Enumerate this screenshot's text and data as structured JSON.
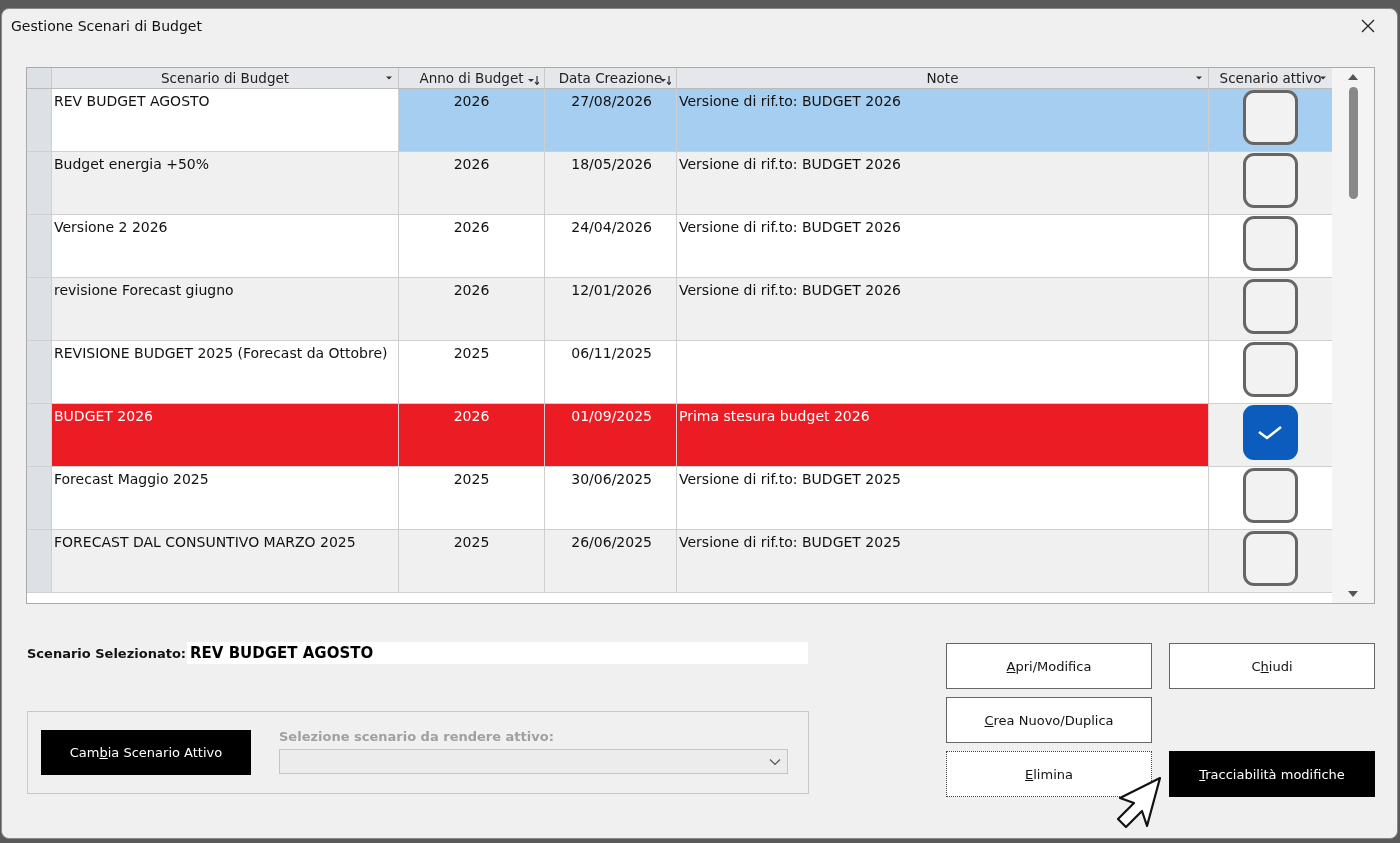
{
  "window": {
    "title": "Gestione Scenari di Budget"
  },
  "table": {
    "columns": [
      {
        "label": "Scenario di Budget",
        "sorted": false
      },
      {
        "label": "Anno di Budget",
        "sorted": true
      },
      {
        "label": "Data Creazione",
        "sorted": true
      },
      {
        "label": "Note",
        "sorted": false
      },
      {
        "label": "Scenario attivo",
        "sorted": false
      }
    ],
    "rows": [
      {
        "cells": [
          "REV BUDGET AGOSTO",
          "2026",
          "27/08/2026",
          "Versione di rif.to: BUDGET 2026"
        ],
        "active": false,
        "selected": true
      },
      {
        "cells": [
          "Budget energia +50%",
          "2026",
          "18/05/2026",
          "Versione di rif.to: BUDGET 2026"
        ],
        "active": false,
        "selected": false
      },
      {
        "cells": [
          "Versione 2 2026",
          "2026",
          "24/04/2026",
          "Versione di rif.to: BUDGET 2026"
        ],
        "active": false,
        "selected": false
      },
      {
        "cells": [
          "revisione Forecast giugno",
          "2026",
          "12/01/2026",
          "Versione di rif.to: BUDGET 2026"
        ],
        "active": false,
        "selected": false
      },
      {
        "cells": [
          "REVISIONE BUDGET 2025 (Forecast da Ottobre)",
          "2025",
          "06/11/2025",
          ""
        ],
        "active": false,
        "selected": false
      },
      {
        "cells": [
          "BUDGET 2026",
          "2026",
          "01/09/2025",
          "Prima stesura budget 2026"
        ],
        "active": true,
        "selected": false
      },
      {
        "cells": [
          "Forecast Maggio 2025",
          "2025",
          "30/06/2025",
          "Versione di rif.to: BUDGET 2025"
        ],
        "active": false,
        "selected": false
      },
      {
        "cells": [
          "FORECAST DAL CONSUNTIVO MARZO 2025",
          "2025",
          "26/06/2025",
          "Versione di rif.to: BUDGET 2025"
        ],
        "active": false,
        "selected": false
      }
    ]
  },
  "selected_scenario": {
    "label": "Scenario Selezionato:",
    "value": "REV BUDGET AGOSTO"
  },
  "change_group": {
    "button": {
      "label": "Cambia Scenario Attivo"
    },
    "combo_label": "Selezione scenario da rendere attivo:",
    "combo_disabled": true
  },
  "buttons": [
    {
      "label": "Apri/Modifica",
      "focused": false
    },
    {
      "label": "Chiudi",
      "focused": false
    },
    {
      "label": "Crea Nuovo/Duplica",
      "focused": false
    },
    {
      "label": "Elimina",
      "focused": true
    },
    {
      "label": "Tracciabilità modifiche",
      "focused": false
    }
  ]
}
